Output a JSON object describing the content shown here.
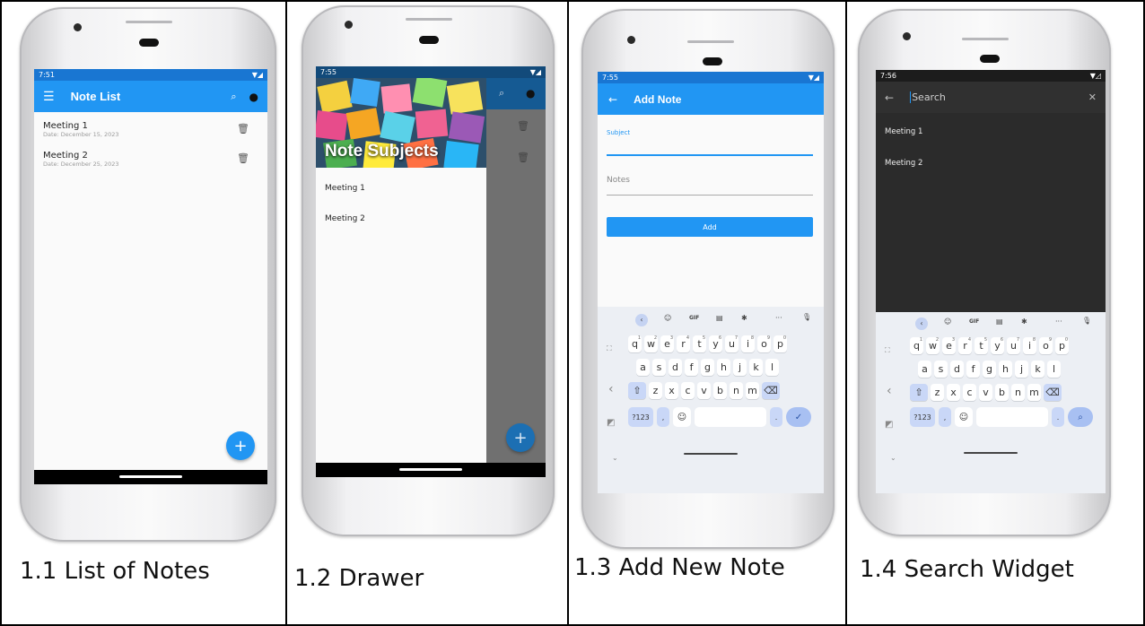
{
  "captions": [
    "1.1 List of Notes",
    "1.2 Drawer",
    "1.3 Add New Note",
    "1.4 Search Widget"
  ],
  "colors": {
    "primary": "#2196f3",
    "dark_bar": "#303030",
    "dark_bg": "#2b2b2b",
    "status_dark": "#1565c0"
  },
  "screen1": {
    "time": "7:51",
    "title": "Note List",
    "notes": [
      {
        "subject": "Meeting 1",
        "date": "Date: December 15, 2023"
      },
      {
        "subject": "Meeting 2",
        "date": "Date: December 25, 2023"
      }
    ],
    "fab": "+"
  },
  "screen2": {
    "time": "7:55",
    "header": "Note Subjects",
    "items": [
      "Meeting 1",
      "Meeting 2"
    ],
    "fab": "+"
  },
  "screen3": {
    "time": "7:55",
    "title": "Add Note",
    "subject_label": "Subject",
    "notes_placeholder": "Notes",
    "add_button": "Add"
  },
  "screen4": {
    "time": "7:56",
    "search_placeholder": "Search",
    "results": [
      "Meeting 1",
      "Meeting 2"
    ]
  },
  "keyboard": {
    "row1": [
      "q",
      "w",
      "e",
      "r",
      "t",
      "y",
      "u",
      "i",
      "o",
      "p"
    ],
    "row1_digits": [
      "1",
      "2",
      "3",
      "4",
      "5",
      "6",
      "7",
      "8",
      "9",
      "0"
    ],
    "row2": [
      "a",
      "s",
      "d",
      "f",
      "g",
      "h",
      "j",
      "k",
      "l"
    ],
    "row3": [
      "z",
      "x",
      "c",
      "v",
      "b",
      "n",
      "m"
    ],
    "gif": "GIF",
    "sym": "?123",
    "comma": ",",
    "period": ".",
    "dots": "···"
  }
}
